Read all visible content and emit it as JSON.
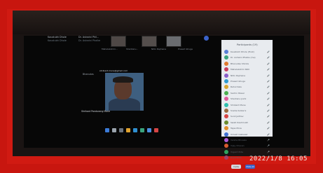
{
  "meeting": {
    "participants_top": [
      {
        "name": "Kaustubh Dhole",
        "sub": "Kaustubh Dhole"
      },
      {
        "name": "Dr. Ashwini Phil...",
        "sub": "Dr. Ashwini Phalke"
      }
    ],
    "thumb_labels": [
      "Mahalakshmi...",
      "Shantanu...",
      "Nitin Rajmane",
      "Prasad Ghuge"
    ],
    "side_label": "Bhanudas",
    "video_name": "Shrikant Pandurang Mane",
    "video_caption": "shrikant.mane@gmail.com",
    "panel": {
      "title": "Participants (19)",
      "items": [
        {
          "name": "Kaustubh Dhole (Host)",
          "color": "#5a7fd6"
        },
        {
          "name": "Dr. Ashwini Phalke (me)",
          "color": "#3aa37d"
        },
        {
          "name": "Bhanudas Shinde",
          "color": "#e07a2f"
        },
        {
          "name": "Mahalakshmi Patil",
          "color": "#c93d5e"
        },
        {
          "name": "Nitin Rajmane",
          "color": "#8a5ec9"
        },
        {
          "name": "Prasad Ghuge",
          "color": "#2f9bd1"
        },
        {
          "name": "Rahul Kale",
          "color": "#d6a52f"
        },
        {
          "name": "Sachin Pawar",
          "color": "#4caf50"
        },
        {
          "name": "Shantanu Joshi",
          "color": "#e05a9b"
        },
        {
          "name": "Shrikant Mane",
          "color": "#2fbfae"
        },
        {
          "name": "Sneha Kulkarni",
          "color": "#9c6b3f"
        },
        {
          "name": "Sunil Jadhav",
          "color": "#d64545"
        },
        {
          "name": "Swati Deshmukh",
          "color": "#6a8c2f"
        },
        {
          "name": "Tejas More",
          "color": "#e0902f"
        },
        {
          "name": "Umesh Gaikwad",
          "color": "#3f6fd1"
        },
        {
          "name": "Varsha Bhosale",
          "color": "#b05ad6"
        },
        {
          "name": "Vijay Chavan",
          "color": "#d65a2f"
        },
        {
          "name": "Yogesh Pote",
          "color": "#2fa35e"
        },
        {
          "name": "Zoya Khan",
          "color": "#a33f6b"
        }
      ],
      "btn_invite": "Invite",
      "btn_mute_all": "Mute All"
    }
  },
  "timestamp": "2022/1/8  16:05"
}
